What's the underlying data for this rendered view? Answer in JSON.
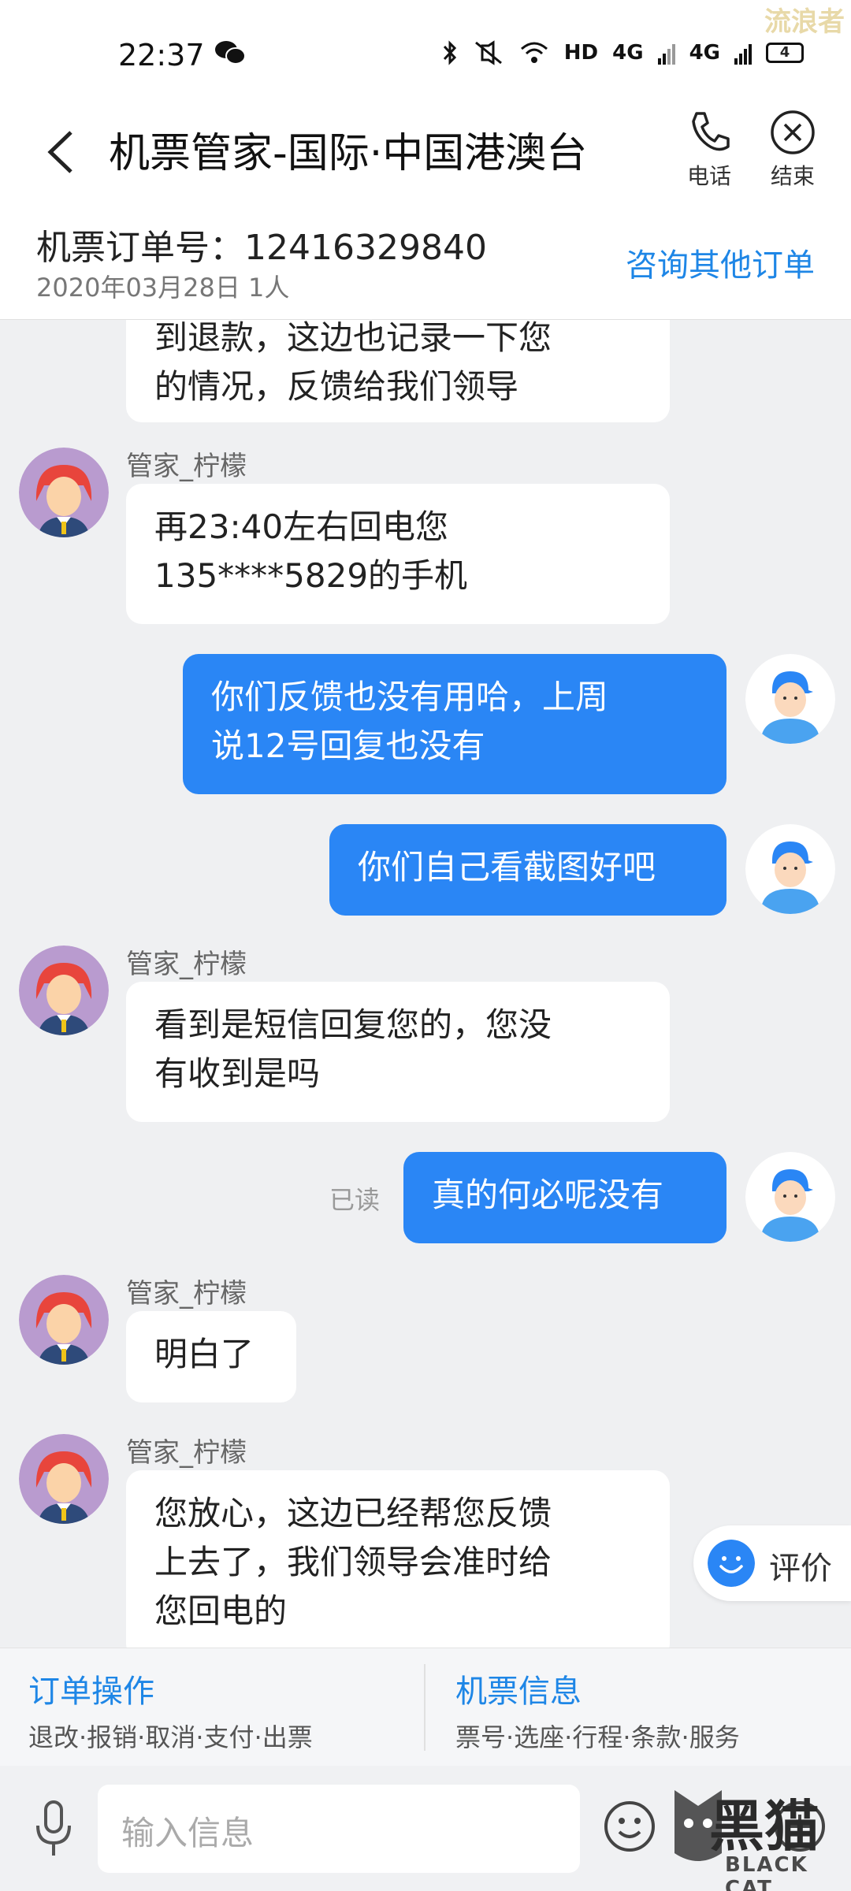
{
  "status_bar": {
    "time": "22:37",
    "network": "HD",
    "signal1": "4G",
    "signal2": "4G",
    "battery": "4"
  },
  "watermark_top": "流浪者",
  "header": {
    "title": "机票管家-国际·中国港澳台",
    "call_label": "电话",
    "end_label": "结束"
  },
  "order": {
    "number": "机票订单号：12416329840",
    "date": "2020年03月28日 1人",
    "other_orders": "咨询其他订单"
  },
  "messages": {
    "m0": {
      "text1": "到退款，这边也记录一下您",
      "text2": "的情况，反馈给我们领导"
    },
    "m1": {
      "sender": "管家_柠檬",
      "text1": "再23:40左右回电您",
      "text2": "135****5829的手机"
    },
    "m2": {
      "text1": "你们反馈也没有用哈，上周",
      "text2": "说12号回复也没有"
    },
    "m3": {
      "text1": "你们自己看截图好吧"
    },
    "m4": {
      "sender": "管家_柠檬",
      "text1": "看到是短信回复您的，您没",
      "text2": "有收到是吗"
    },
    "m5": {
      "read": "已读",
      "text1": "真的何必呢没有"
    },
    "m6": {
      "sender": "管家_柠檬",
      "text1": "明白了"
    },
    "m7": {
      "sender": "管家_柠檬",
      "text1": "您放心，这边已经帮您反馈",
      "text2": "上去了，我们领导会准时给",
      "text3": "您回电的"
    }
  },
  "rate": {
    "label": "评价"
  },
  "panel": {
    "order_ops": {
      "title": "订单操作",
      "sub": "退改·报销·取消·支付·出票"
    },
    "ticket_info": {
      "title": "机票信息",
      "sub": "票号·选座·行程·条款·服务"
    }
  },
  "input": {
    "placeholder": "输入信息"
  },
  "watermark_bottom": {
    "big": "黑猫",
    "small": "BLACK CAT"
  },
  "colors": {
    "accent": "#1e86e6",
    "out_bubble": "#2a86f5",
    "background": "#eff0f2"
  }
}
